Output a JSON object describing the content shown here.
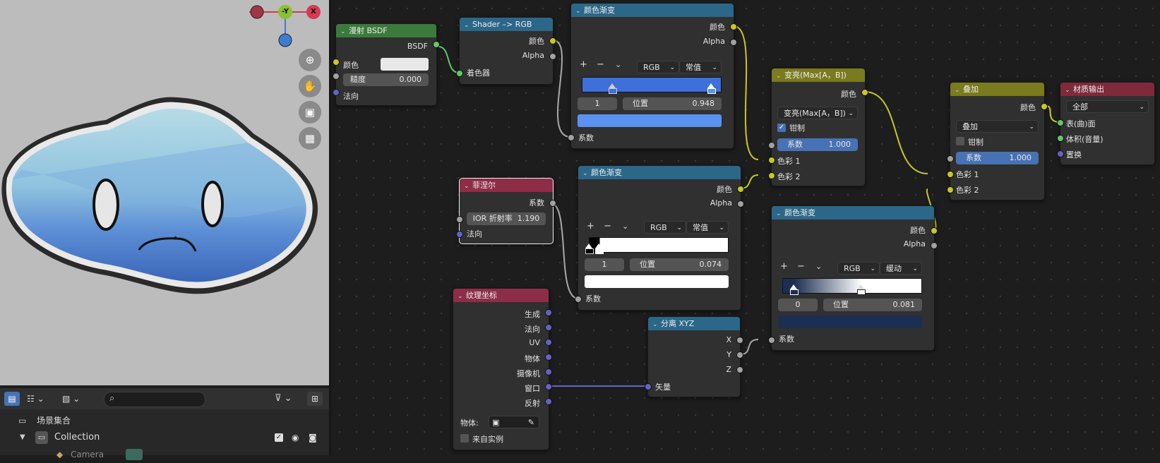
{
  "viewport": {
    "gizmo": {
      "y_label": "-Y",
      "x_label": "X"
    },
    "colors": {
      "bg": "#bcbcbc",
      "blob_light": "#9fcfe0",
      "blob_dark": "#3f74c4"
    }
  },
  "outliner": {
    "scene_collection": "场景集合",
    "collection": "Collection",
    "camera_partial": "Camera"
  },
  "nodes": {
    "diffuse": {
      "title": "漫射 BSDF",
      "out_bsdf": "BSDF",
      "in_color": "颜色",
      "roughness_label": "糙度",
      "roughness_value": "0.000",
      "in_normal": "法向"
    },
    "shader_rgb": {
      "title": "Shader –> RGB",
      "out_color": "颜色",
      "out_alpha": "Alpha",
      "in_shader": "着色器"
    },
    "ramp1": {
      "title": "颜色渐变",
      "out_color": "颜色",
      "out_alpha": "Alpha",
      "add": "+",
      "remove": "−",
      "mode": "RGB",
      "interp": "常值",
      "index": "1",
      "pos_label": "位置",
      "pos_value": "0.948",
      "in_fac": "系数"
    },
    "fresnel": {
      "title": "菲涅尔",
      "out_fac": "系数",
      "ior_label": "IOR 折射率",
      "ior_value": "1.190",
      "in_normal": "法向"
    },
    "ramp2": {
      "title": "颜色渐变",
      "out_color": "颜色",
      "out_alpha": "Alpha",
      "add": "+",
      "remove": "−",
      "mode": "RGB",
      "interp": "常值",
      "index": "1",
      "pos_label": "位置",
      "pos_value": "0.074",
      "in_fac": "系数"
    },
    "texcoord": {
      "title": "纹理坐标",
      "outputs": [
        "生成",
        "法向",
        "UV",
        "物体",
        "摄像机",
        "窗口",
        "反射"
      ],
      "object_label": "物体:",
      "from_instancer": "来自实例"
    },
    "sepxyz": {
      "title": "分离 XYZ",
      "out_x": "X",
      "out_y": "Y",
      "out_z": "Z",
      "in_vector": "矢量"
    },
    "lighten": {
      "title": "变亮(Max[A，B])",
      "out_color": "颜色",
      "blend": "变亮(Max[A，B])",
      "clamp": "钳制",
      "fac_label": "系数",
      "fac_value": "1.000",
      "in_c1": "色彩 1",
      "in_c2": "色彩 2"
    },
    "ramp3": {
      "title": "颜色渐变",
      "out_color": "颜色",
      "out_alpha": "Alpha",
      "add": "+",
      "remove": "−",
      "mode": "RGB",
      "interp": "缓动",
      "index": "0",
      "pos_label": "位置",
      "pos_value": "0.081",
      "in_fac": "系数"
    },
    "add": {
      "title": "叠加",
      "out_color": "颜色",
      "blend": "叠加",
      "clamp": "钳制",
      "fac_label": "系数",
      "fac_value": "1.000",
      "in_c1": "色彩 1",
      "in_c2": "色彩 2"
    },
    "output": {
      "title": "材质输出",
      "target": "全部",
      "in_surface": "表(曲)面",
      "in_volume": "体积(音量)",
      "in_disp": "置换"
    }
  },
  "colors": {
    "ramp1": "#5b92ef",
    "ramp3": "#1c2e52",
    "white": "#ffffff"
  }
}
